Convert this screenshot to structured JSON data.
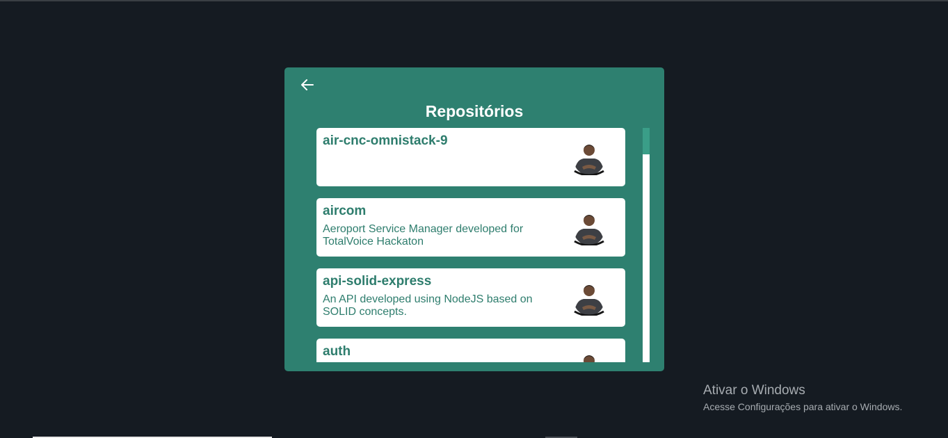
{
  "panel": {
    "title": "Repositórios",
    "back_icon": "arrow-left-icon"
  },
  "repos": [
    {
      "name": "air-cnc-omnistack-9",
      "description": "",
      "avatar": "user-avatar"
    },
    {
      "name": "aircom",
      "description": "Aeroport Service Manager developed for TotalVoice Hackaton",
      "avatar": "user-avatar"
    },
    {
      "name": "api-solid-express",
      "description": "An API developed using NodeJS based on SOLID concepts.",
      "avatar": "user-avatar"
    },
    {
      "name": "auth",
      "description": "",
      "avatar": "user-avatar"
    }
  ],
  "scroll": {
    "position_fraction": 0.0
  },
  "watermark": {
    "title": "Ativar o Windows",
    "subtitle": "Acesse Configurações para ativar o Windows."
  },
  "colors": {
    "background": "#151b22",
    "panel": "#2e8070",
    "card": "#ffffff",
    "repo_text": "#2e7d6d",
    "scroll_thumb": "#3a9e88"
  }
}
